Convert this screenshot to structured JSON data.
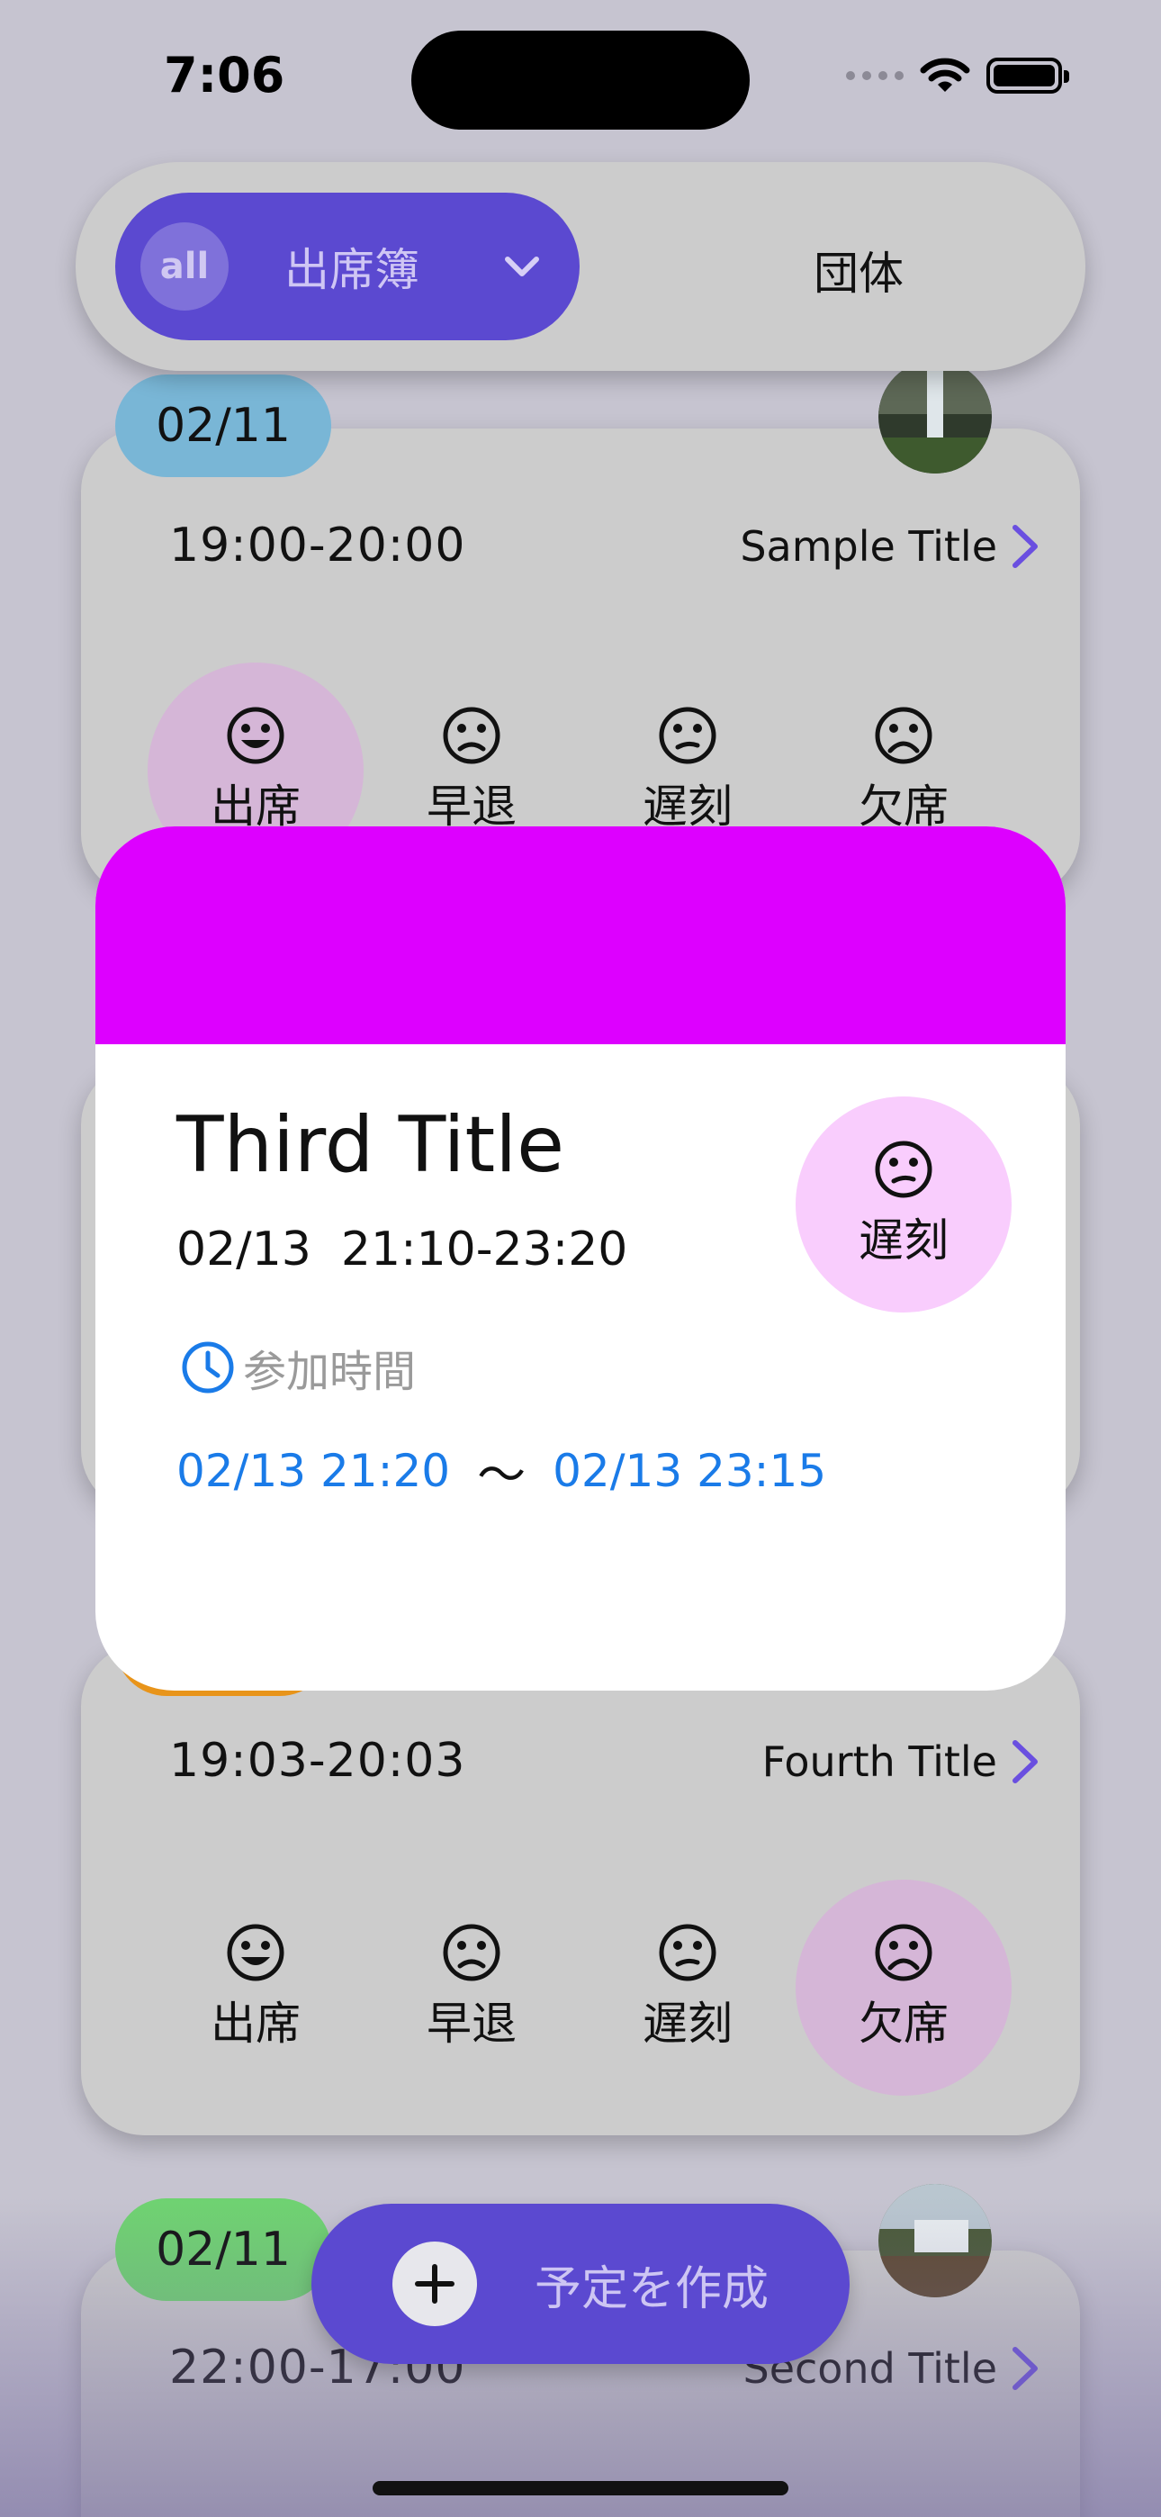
{
  "status_bar": {
    "time": "7:06"
  },
  "segment": {
    "all_badge": "all",
    "active_label": "出席簿",
    "other_label": "団体",
    "accent": "#5b49d0"
  },
  "cards": [
    {
      "date": "02/11",
      "date_color": "#79b6d6",
      "time": "19:00-20:00",
      "title": "Sample Title",
      "statuses": [
        "出席",
        "早退",
        "遅刻",
        "欠席"
      ],
      "selected_status": "出席"
    },
    {
      "time": "19:03-20:03",
      "title": "Fourth Title",
      "statuses": [
        "出席",
        "早退",
        "遅刻",
        "欠席"
      ],
      "selected_status": "欠席"
    },
    {
      "date": "02/11",
      "date_color": "#6fd371",
      "time": "22:00-17:00",
      "title": "Second Title"
    }
  ],
  "modal": {
    "header_color": "#dd00ff",
    "title": "Third Title",
    "date_time": "02/13  21:10-23:20",
    "status": "遅刻",
    "join_label": "参加時間",
    "join_start": "02/13 21:20",
    "join_separator": "〜",
    "join_end": "02/13 23:15"
  },
  "fab": {
    "label": "予定を作成",
    "icon": "plus-icon"
  }
}
